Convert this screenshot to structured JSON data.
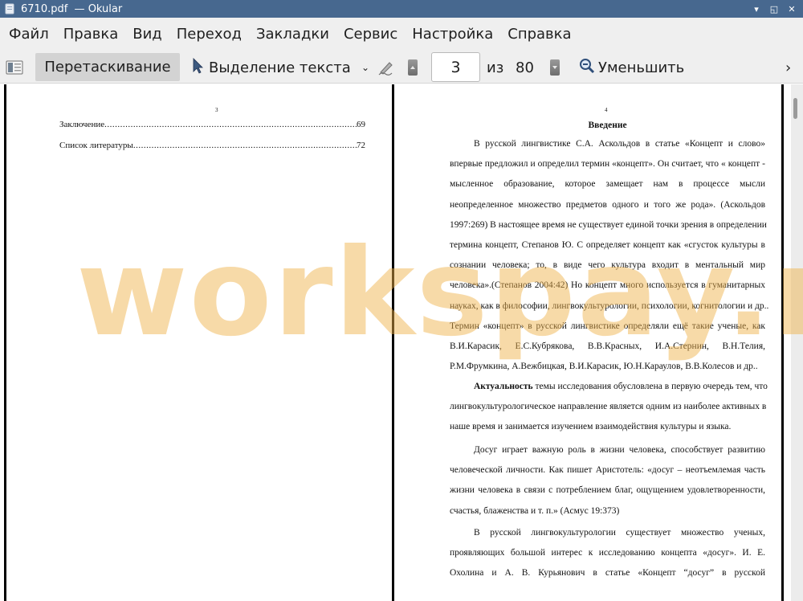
{
  "window": {
    "title": "6710.pdf  — Okular",
    "controls": {
      "minimize": "▾",
      "maximize": "◱",
      "close": "✕"
    },
    "icon": "okular-app-icon"
  },
  "menu": [
    "Файл",
    "Правка",
    "Вид",
    "Переход",
    "Закладки",
    "Сервис",
    "Настройка",
    "Справка"
  ],
  "toolbar": {
    "drag_label": "Перетаскивание",
    "select_text_label": "Выделение текста",
    "dropdown": "⌄",
    "page_value": "3",
    "of_label": "из",
    "total_pages": "80",
    "zoom_out_label": "Уменьшить",
    "more": "›"
  },
  "left_page": {
    "page_number": "3",
    "toc": [
      {
        "title": "Заключение",
        "page": "69"
      },
      {
        "title": "Список литературы",
        "page": "72"
      }
    ]
  },
  "right_page": {
    "page_number": "4",
    "heading": "Введение",
    "paragraphs": [
      {
        "lines": [
          "В русской лингвистике С.А. Аскольдов в статье «Концепт и слово»",
          "впервые предложил и определил термин «концепт». Он считает, что « концепт -",
          "мысленное образование, которое замещает нам в процессе мысли",
          "неопределенное множество предметов одного и того же рода». (Аскольдов",
          "1997:269) В настоящее время не существует единой точки зрения в определении",
          "термина концепт, Степанов Ю. С определяет концепт как «сгусток культуры в",
          "сознании человека; то, в виде чего культура входит в ментальный мир",
          "человека».(Степанов 2004:42) Но концепт много используется в гуманитарных",
          "науках, как в философии, лингвокультурологии, психологии, когнитологии и др..",
          "Термин «концепт» в русской лингвистике определяли ещё такие ученые, как",
          "В.И.Карасик,     Е.С.Кубрякова,     В.В.Красных,     И.А.Стернин,     В.Н.Телия,",
          "Р.М.Фрумкина, А.Вежбицкая, В.И.Карасик, Ю.Н.Караулов,   В.В.Колесов и др.."
        ]
      },
      {
        "bold_lead": "Актуальность",
        "lines": [
          " темы исследования обусловлена в первую очередь тем, что",
          "лингвокультурологическое направление является одним из наиболее активных в",
          "наше время и занимается изучением взаимодействия культуры и языка."
        ]
      },
      {
        "lines": [
          "Досуг играет важную роль в жизни человека, способствует развитию",
          "человеческой личности. Как пишет Аристотель: «досуг – неотъемлемая часть",
          "жизни человека в связи с потреблением благ, ощущением удовлетворенности,",
          "счастья, блаженства и т. п.» (Асмус 19:373)"
        ]
      },
      {
        "lines": [
          "В русской лингвокультурологии существует множество ученых,",
          "проявляющих большой интерес к исследованию концепта «досуг». И. Е.",
          "Охолина и А. В. Курьянович в статье «Концепт “досуг” в русской"
        ]
      }
    ]
  },
  "watermark": "workspay.ru",
  "colors": {
    "titlebar": "#47688f",
    "toolbar": "#efefef",
    "watermark": "#f0b24a"
  },
  "icons": {
    "sidebar": "sidebar-toggle-icon",
    "cursor": "text-select-cursor-icon",
    "sign": "signature-pen-icon",
    "prev": "previous-page-icon",
    "next": "next-page-icon",
    "zoom": "zoom-out-magnifier-icon"
  }
}
